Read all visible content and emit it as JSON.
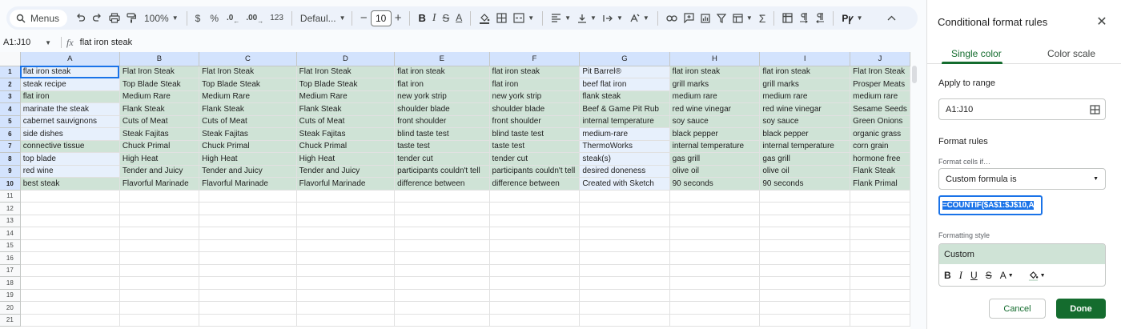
{
  "toolbar": {
    "menus_label": "Menus",
    "zoom": "100%",
    "currency": "$",
    "percent": "%",
    "dec_decrease": ".0",
    "dec_increase": ".00",
    "number_format": "123",
    "font": "Defaul...",
    "font_size": "10",
    "bold": "B",
    "font_color_letter": "A",
    "sigma": "Σ"
  },
  "formula_bar": {
    "name_box": "A1:J10",
    "fx": "fx",
    "content": "flat iron steak"
  },
  "grid": {
    "columns": [
      "A",
      "B",
      "C",
      "D",
      "E",
      "F",
      "G",
      "H",
      "I",
      "J"
    ],
    "rows": [
      [
        "flat iron steak",
        "Flat Iron Steak",
        "Flat Iron Steak",
        "Flat Iron Steak",
        "flat iron steak",
        "flat iron steak",
        "Pit Barrel®",
        "flat iron steak",
        "flat iron steak",
        "Flat Iron Steak"
      ],
      [
        "steak recipe",
        "Top Blade Steak",
        "Top Blade Steak",
        "Top Blade Steak",
        "flat iron",
        "flat iron",
        "beef flat iron",
        "grill marks",
        "grill marks",
        "Prosper Meats"
      ],
      [
        "flat iron",
        "Medium Rare",
        "Medium Rare",
        "Medium Rare",
        "new york strip",
        "new york strip",
        "flank steak",
        "medium rare",
        "medium rare",
        "medium rare"
      ],
      [
        "marinate the steak",
        "Flank Steak",
        "Flank Steak",
        "Flank Steak",
        "shoulder blade",
        "shoulder blade",
        "Beef & Game Pit Rub",
        "red wine vinegar",
        "red wine vinegar",
        "Sesame Seeds"
      ],
      [
        "cabernet sauvignons",
        "Cuts of Meat",
        "Cuts of Meat",
        "Cuts of Meat",
        "front shoulder",
        "front shoulder",
        "internal temperature",
        "soy sauce",
        "soy sauce",
        "Green Onions"
      ],
      [
        "side dishes",
        "Steak Fajitas",
        "Steak Fajitas",
        "Steak Fajitas",
        "blind taste test",
        "blind taste test",
        "medium-rare",
        "black pepper",
        "black pepper",
        "organic grass"
      ],
      [
        "connective tissue",
        "Chuck Primal",
        "Chuck Primal",
        "Chuck Primal",
        "taste test",
        "taste test",
        "ThermoWorks",
        "internal temperature",
        "internal temperature",
        "corn grain"
      ],
      [
        "top blade",
        "High Heat",
        "High Heat",
        "High Heat",
        "tender cut",
        "tender cut",
        "steak(s)",
        "gas grill",
        "gas grill",
        "hormone free"
      ],
      [
        "red wine",
        "Tender and Juicy",
        "Tender and Juicy",
        "Tender and Juicy",
        "participants couldn't tell",
        "participants couldn't tell",
        "desired doneness",
        "olive oil",
        "olive oil",
        "Flank Steak"
      ],
      [
        "best steak",
        "Flavorful Marinade",
        "Flavorful Marinade",
        "Flavorful Marinade",
        "difference between",
        "difference between",
        "Created with Sketch",
        "90 seconds",
        "90 seconds",
        "Flank Primal"
      ]
    ],
    "highlight": [
      [
        0,
        1,
        1,
        1,
        1,
        1,
        0,
        1,
        1,
        1
      ],
      [
        0,
        1,
        1,
        1,
        1,
        1,
        0,
        1,
        1,
        1
      ],
      [
        1,
        1,
        1,
        1,
        1,
        1,
        1,
        1,
        1,
        1
      ],
      [
        0,
        1,
        1,
        1,
        1,
        1,
        1,
        1,
        1,
        1
      ],
      [
        0,
        1,
        1,
        1,
        1,
        1,
        1,
        1,
        1,
        1
      ],
      [
        0,
        1,
        1,
        1,
        1,
        1,
        0,
        1,
        1,
        1
      ],
      [
        1,
        1,
        1,
        1,
        1,
        1,
        0,
        1,
        1,
        1
      ],
      [
        0,
        1,
        1,
        1,
        1,
        1,
        0,
        1,
        1,
        1
      ],
      [
        0,
        1,
        1,
        1,
        1,
        1,
        0,
        1,
        1,
        1
      ],
      [
        1,
        1,
        1,
        1,
        1,
        1,
        0,
        1,
        1,
        1
      ]
    ],
    "empty_row_numbers": [
      "11",
      "12",
      "13",
      "14",
      "15",
      "16",
      "17",
      "18",
      "19",
      "20",
      "21"
    ]
  },
  "panel": {
    "title": "Conditional format rules",
    "tab_single": "Single color",
    "tab_scale": "Color scale",
    "apply_label": "Apply to range",
    "range_value": "A1:J10",
    "format_rules_label": "Format rules",
    "format_cells_if_label": "Format cells if…",
    "condition_value": "Custom formula is",
    "formula_value": "=COUNTIF($A$1:$J$10,A",
    "formatting_style_label": "Formatting style",
    "style_preview": "Custom",
    "style_bold": "B",
    "style_italic": "I",
    "style_underline": "U",
    "style_strike": "S",
    "style_text_color": "A",
    "cancel_label": "Cancel",
    "done_label": "Done"
  },
  "colors": {
    "highlight_fill": "#cfe3d6",
    "selection_fill": "#e7f0fc",
    "accent_green": "#146c2e",
    "accent_blue": "#1a73e8"
  }
}
